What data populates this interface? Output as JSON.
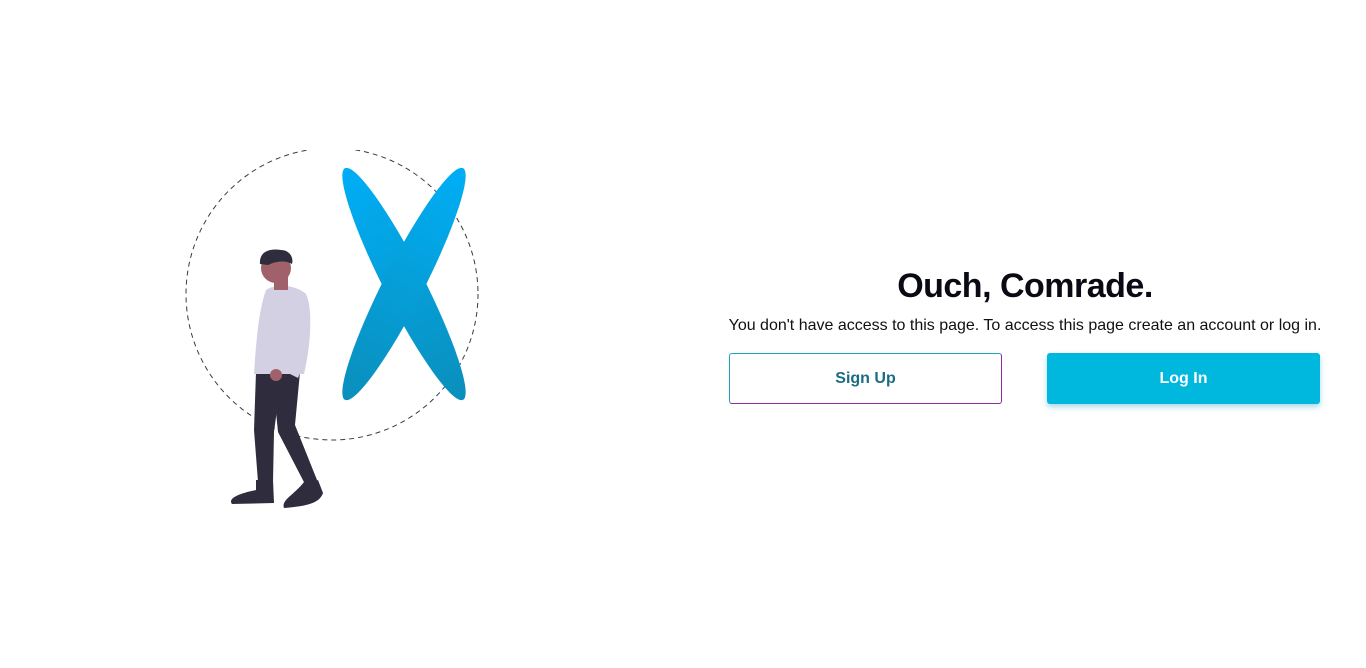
{
  "illustration": {
    "name": "access-denied-illustration",
    "accent_top": "#00aef6",
    "accent_bottom": "#0a8fbb"
  },
  "content": {
    "title": "Ouch, Comrade.",
    "message": "You don't have access to this page. To access this page create an account or log in."
  },
  "actions": {
    "signup_label": "Sign Up",
    "login_label": "Log In"
  },
  "colors": {
    "primary": "#00b8dd",
    "signup_text": "#1b6b85"
  }
}
